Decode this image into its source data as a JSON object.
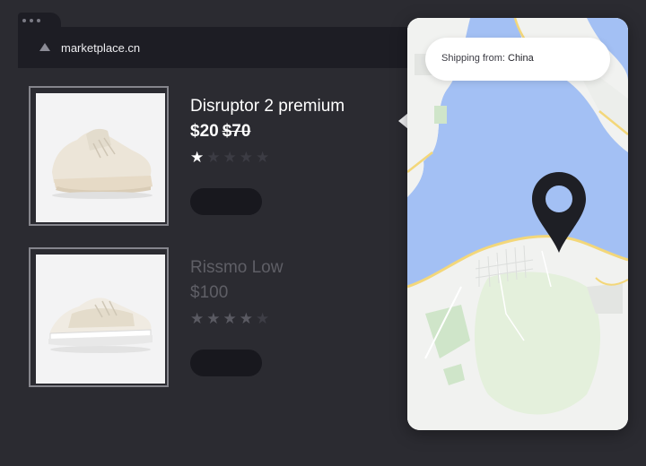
{
  "browser": {
    "url": "marketplace.cn"
  },
  "products": [
    {
      "title": "Disruptor 2 premium",
      "price": "$20",
      "original_price": "$70",
      "rating_stars": 1,
      "rating_max": 5
    },
    {
      "title": "Rissmo Low",
      "price": "$100",
      "rating_stars": 4,
      "rating_max": 5
    }
  ],
  "map": {
    "shipping_label": "Shipping from:",
    "shipping_country": "China",
    "pin_icon": "map-pin-icon"
  },
  "colors": {
    "background": "#2b2b31",
    "water": "#a3c0f4",
    "road": "#f3d77a",
    "park": "#cfe5c9"
  }
}
